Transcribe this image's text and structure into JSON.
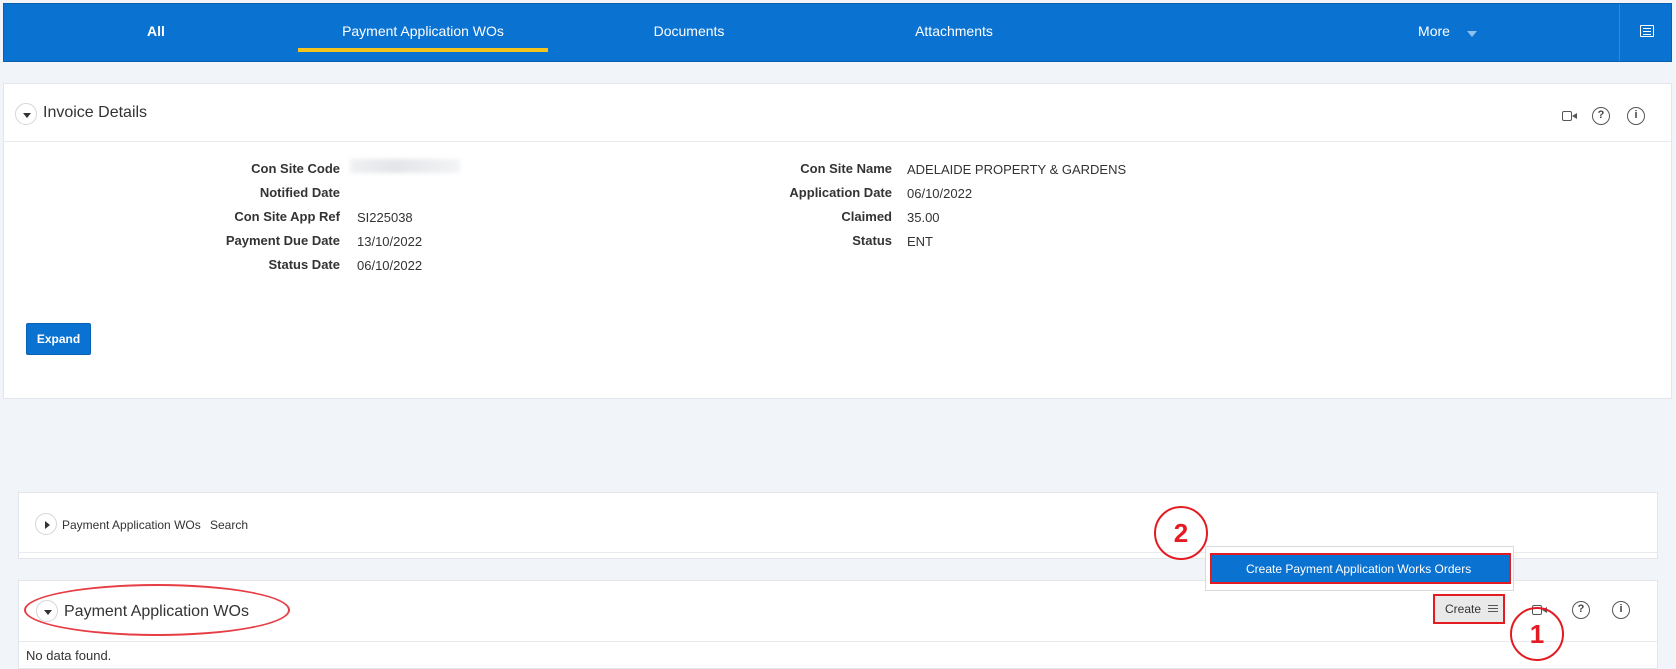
{
  "nav": {
    "tabs": [
      {
        "label": "All"
      },
      {
        "label": "Payment Application WOs"
      },
      {
        "label": "Documents"
      },
      {
        "label": "Attachments"
      },
      {
        "label": "More"
      }
    ]
  },
  "invoice": {
    "title": "Invoice Details",
    "left_fields": [
      {
        "label": "Con Site Code",
        "value": ""
      },
      {
        "label": "Notified Date",
        "value": ""
      },
      {
        "label": "Con Site App Ref",
        "value": "SI225038"
      },
      {
        "label": "Payment Due Date",
        "value": "13/10/2022"
      },
      {
        "label": "Status Date",
        "value": "06/10/2022"
      }
    ],
    "right_fields": [
      {
        "label": "Con Site Name",
        "value": "ADELAIDE PROPERTY & GARDENS"
      },
      {
        "label": "Application Date",
        "value": "06/10/2022"
      },
      {
        "label": "Claimed",
        "value": "35.00"
      },
      {
        "label": "Status",
        "value": "ENT"
      }
    ],
    "expand_label": "Expand",
    "icons": [
      "camera-icon",
      "help-icon",
      "info-icon"
    ]
  },
  "search_panel": {
    "label": "Payment Application WOs",
    "suffix": "Search"
  },
  "wo_panel": {
    "title": "Payment Application WOs",
    "create_label": "Create",
    "no_data": "No data found.",
    "icons": [
      "camera-icon",
      "help-icon",
      "info-icon"
    ]
  },
  "create_menu": {
    "item": "Create Payment Application Works Orders"
  },
  "annotations": {
    "step1": "1",
    "step2": "2"
  },
  "colors": {
    "nav_bg": "#0a72d1",
    "active_tab_underline": "#f4c31c",
    "annotation_red": "#e31b23",
    "page_bg": "#f1f4f8"
  }
}
